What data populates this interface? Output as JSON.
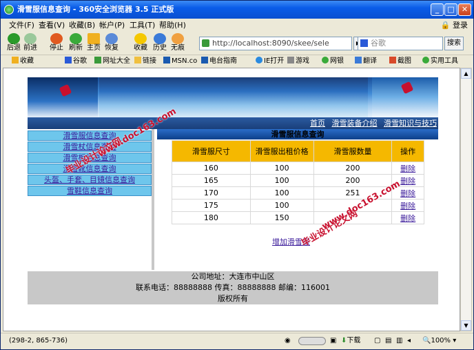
{
  "window": {
    "title": "滑雪服信息查询 - 360安全浏览器 3.5 正式版"
  },
  "menu": {
    "items": [
      "文件(F)",
      "查看(V)",
      "收藏(B)",
      "帐户(P)",
      "工具(T)",
      "帮助(H)"
    ],
    "login": "登录"
  },
  "nav": {
    "back": "后退",
    "forward": "前进",
    "stop": "停止",
    "refresh": "刷新",
    "home": "主页",
    "restore": "恢复",
    "favorites": "收藏",
    "history": "历史",
    "traceless": "无痕",
    "address": "http://localhost:8090/skee/sele",
    "search_placeholder": "谷歌",
    "search_button": "搜索"
  },
  "favbar": {
    "items": [
      "收藏",
      "谷歌",
      "网址大全",
      "链接",
      "MSN.co",
      "电台指南",
      "IE打开",
      "游戏",
      "网银",
      "翻译",
      "截图",
      "实用工具"
    ]
  },
  "site": {
    "topnav": [
      "首页",
      "滑雪装备介绍",
      "滑雪知识与技巧"
    ],
    "sidebar": [
      "滑雪服信息查询",
      "滑雪杖信息查询",
      "滑雪板信息查询",
      "滑雪靴信息查询",
      "头盔、手套、目镜信息查询",
      "雪鞋信息查询"
    ],
    "content_title": "滑雪服信息查询",
    "table": {
      "headers": [
        "滑雪服尺寸",
        "滑雪服出租价格",
        "滑雪服数量",
        "操作"
      ],
      "rows": [
        [
          "160",
          "100",
          "200",
          "删除"
        ],
        [
          "165",
          "100",
          "200",
          "删除"
        ],
        [
          "170",
          "100",
          "251",
          "删除"
        ],
        [
          "175",
          "100",
          "",
          "删除"
        ],
        [
          "180",
          "150",
          "",
          "删除"
        ]
      ]
    },
    "add_link": "增加滑雪服",
    "footer": {
      "address": "公司地址：大连市中山区",
      "contact": "联系电话：88888888 传真：88888888 邮编：116001",
      "copyright": "版权所有"
    }
  },
  "watermarks": [
    "毕业设计论文网",
    "www.doc163.com"
  ],
  "status": {
    "text": "(298-2, 865-736)",
    "download": "下载",
    "zoom": "100%"
  },
  "colors": {
    "table_header": "#f5b800",
    "sidebar_item": "#6ec6ec",
    "footer": "#c8c8c8",
    "watermark": "#c8102e"
  }
}
